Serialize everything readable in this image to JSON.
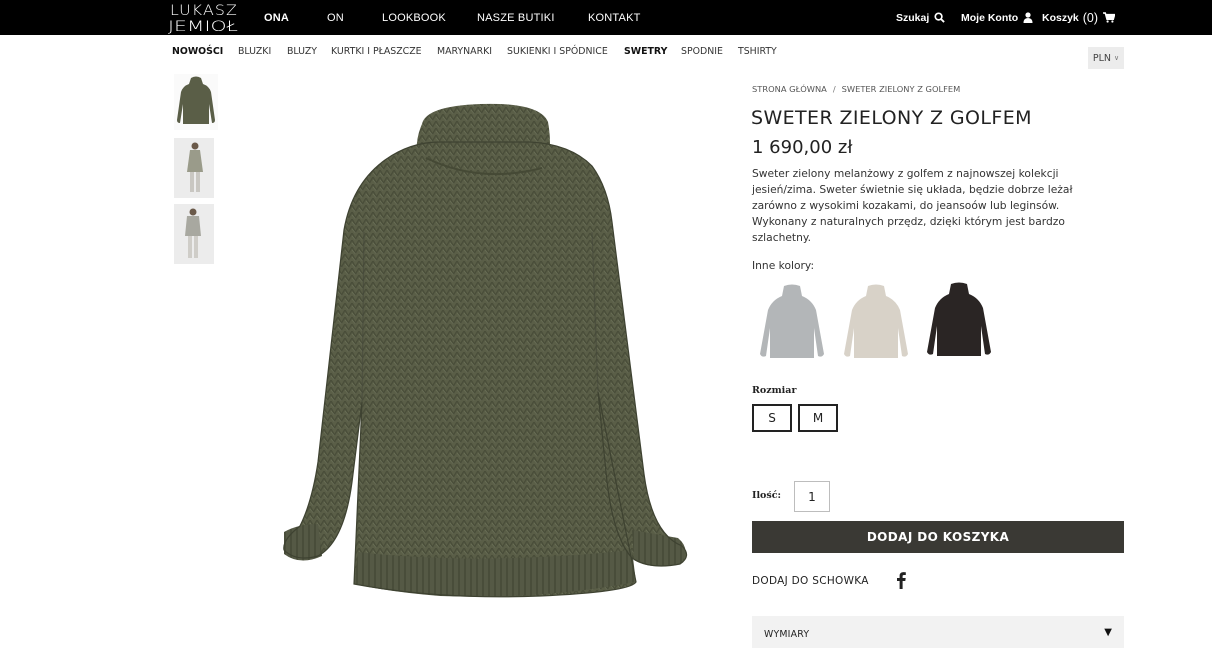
{
  "brand": {
    "logo_line1": "LUKASZ",
    "logo_line2": "JEMIOŁ"
  },
  "top_nav": {
    "items": [
      "ONA",
      "ON",
      "LOOKBOOK",
      "NASZE BUTIKI",
      "KONTAKT"
    ],
    "active": "ONA"
  },
  "tools": {
    "search_label": "Szukaj",
    "search_icon": "search-icon",
    "account_label": "Moje Konto",
    "account_icon": "user-icon",
    "cart_label": "Koszyk",
    "cart_count": "(0)",
    "cart_icon": "shopping-cart-icon"
  },
  "categories": {
    "items": [
      "NOWOŚCI",
      "BLUZKI",
      "BLUZY",
      "KURTKI I PŁASZCZE",
      "MARYNARKI",
      "SUKIENKI I SPÓDNICE",
      "SWETRY",
      "SPODNIE",
      "TSHIRTY"
    ],
    "bold": [
      "NOWOŚCI",
      "SWETRY"
    ]
  },
  "currency": {
    "value": "PLN",
    "caret": "∨"
  },
  "breadcrumb": {
    "home": "STRONA GŁÓWNA",
    "separator": "/",
    "current": "SWETER ZIELONY Z GOLFEM"
  },
  "product": {
    "title": "SWETER ZIELONY Z GOLFEM",
    "price": "1 690,00 zł",
    "description": "Sweter zielony melanżowy z golfem z najnowszej kolekcji jesień/zima. Sweter świetnie się układa, będzie dobrze leżał zarówno z wysokimi kozakami, do jeansoów lub leginsów. Wykonany z naturalnych przędz, dzięki którym jest bardzo szlachetny.",
    "other_colors_label": "Inne kolory:",
    "other_colors": [
      {
        "name": "grey",
        "hex": "#b3b6b8"
      },
      {
        "name": "beige",
        "hex": "#d8d2c8"
      },
      {
        "name": "black",
        "hex": "#2a2524"
      }
    ],
    "main_color": "#5a5e47",
    "size_label": "Rozmiar",
    "sizes": [
      "S",
      "M"
    ],
    "quantity_label": "Ilość:",
    "quantity_value": "1",
    "add_to_cart": "DODAJ DO KOSZYKA",
    "add_to_wishlist": "DODAJ DO SCHOWKA",
    "facebook_icon": "facebook-icon",
    "accordion_label": "WYMIARY",
    "accordion_arrow": "▼"
  },
  "colors": {
    "topbar": "#000000",
    "button": "#3a3934",
    "accordion": "#f2f2f2"
  }
}
